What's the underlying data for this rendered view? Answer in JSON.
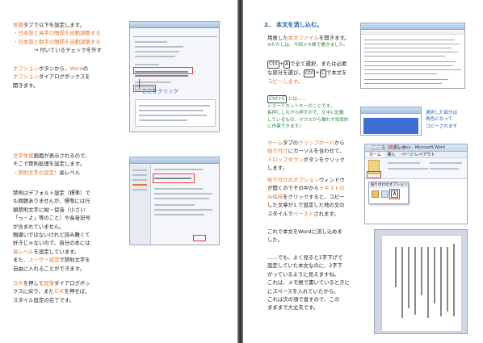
{
  "left_page": {
    "section1": {
      "l1a": "体裁",
      "l1b": "タブで以下を設定します。",
      "l2": "・日本語と英字の間隔を自動調整する",
      "l3": "・日本語と数字の間隔を自動調整する",
      "l4": "→ 付いているチェックを外す",
      "p2a": "オプション",
      "p2b": "ボタンから、",
      "p2c": "Word",
      "p2d": "の",
      "p2e": "オプション",
      "p2f": "ダイアログボックスを",
      "p2g": "開きます。",
      "callout": "ここをクリック"
    },
    "section2": {
      "l1a": "文字体裁",
      "l1b": "画面が表示されるので、",
      "l2": "そこで禁則処理を設定します。",
      "l3a": "・禁則文字の設定",
      "l3b": "：高レベル",
      "p1": "禁則はデフォルト設定（標準）で",
      "p2": "も問題ありませんが、標準には行",
      "p3": "頭禁則文字に拗・促音（小さい",
      "p4": "「っ・よ」等のこと）や長音記号",
      "p5": "が含まれていません。",
      "p6": "間違いではないけれど読み難くて",
      "p7": "好きじゃないので、自分の本には",
      "p8a": "高レベル",
      "p8b": "を設定しています。",
      "p9a": "また、",
      "p9b": "ユーザー設定",
      "p9c": "で禁則文字を",
      "p10": "自由に入れることができます。",
      "p11a": "ＯＫ",
      "p11b": "を押して",
      "p11c": "段落",
      "p11d": "ダイアログボッ",
      "p12a": "クスに戻り、また",
      "p12b": "ＯＫ",
      "p12c": "を押せば、",
      "p13": "スタイル設定の完了です。"
    }
  },
  "right_page": {
    "heading": "2.　本文を流し込む。",
    "p1a": "用意した",
    "p1b": "本文ファイル",
    "p1c": "を開きます。",
    "note1": "※わたしは、今回メモ帳で書きました。",
    "p2a": "Ctrl",
    "p2b": "A",
    "p2c": "で全て選択、または必要",
    "p3a": "な部分を選び、",
    "p3b": "Ctrl",
    "p3c": "C",
    "p3d": "で本文を",
    "p4": "コピーします。",
    "tip_key": "Ctrl+C",
    "tip_a": "とは……",
    "tip_b": "ショートカットキーのことです。",
    "tip_c": "長押ししながら押すので、文中に記載",
    "tip_d": "しているもの。マウスから離れず効率的",
    "tip_e": "に作業できます♪",
    "side_note1": "選択した部分は",
    "side_note2": "青色になって",
    "side_note3": "コピーされます",
    "callout2": "ここをクリック",
    "p5a": "ホーム",
    "p5b": "タブの",
    "p5c": "クリップボード",
    "p5d": "から",
    "p6a": "貼り付け",
    "p6b": "にカーソルを合わせて、",
    "p7a": "ドロップダウン",
    "p7b": "ボタンをクリック",
    "p8": "します。",
    "p9a": "貼り付けのオプション",
    "p9b": "ウィンドウ",
    "p10a": "が開くので",
    "p10b": "その中から",
    "p10c": "テキストの",
    "p11a": "み保持",
    "p11b": "をクリックすると、コピー",
    "p12": "した文章が1.で設定した地の文の",
    "p13a": "スタイルで",
    "p13b": "ペースト",
    "p13c": "されます。",
    "p14": "これで本文をWordに流し込めま",
    "p15": "した。",
    "p16": "……でも、よく見ると1字下げで",
    "p17": "設定していた本文なのに、2字下",
    "p18": "がっているように見えますね。",
    "p19": "これは、メモ帳で書いているときに",
    "p20": "にスペースを入れていたから。",
    "p21": "これは次の項で直すので、この",
    "p22": "まままで大丈夫です。",
    "word_title": "文書1.docx - Microsoft Word",
    "word_tab_home": "ホーム",
    "word_tab_insert": "挿入",
    "word_tab_page": "ページ レイアウト",
    "word_paste_label": "貼り付けのオプション:"
  },
  "colors": {
    "orange": "#e8752a",
    "red": "#d23a2a",
    "blue": "#1f5fae",
    "gutter": "#3b3b3b"
  }
}
